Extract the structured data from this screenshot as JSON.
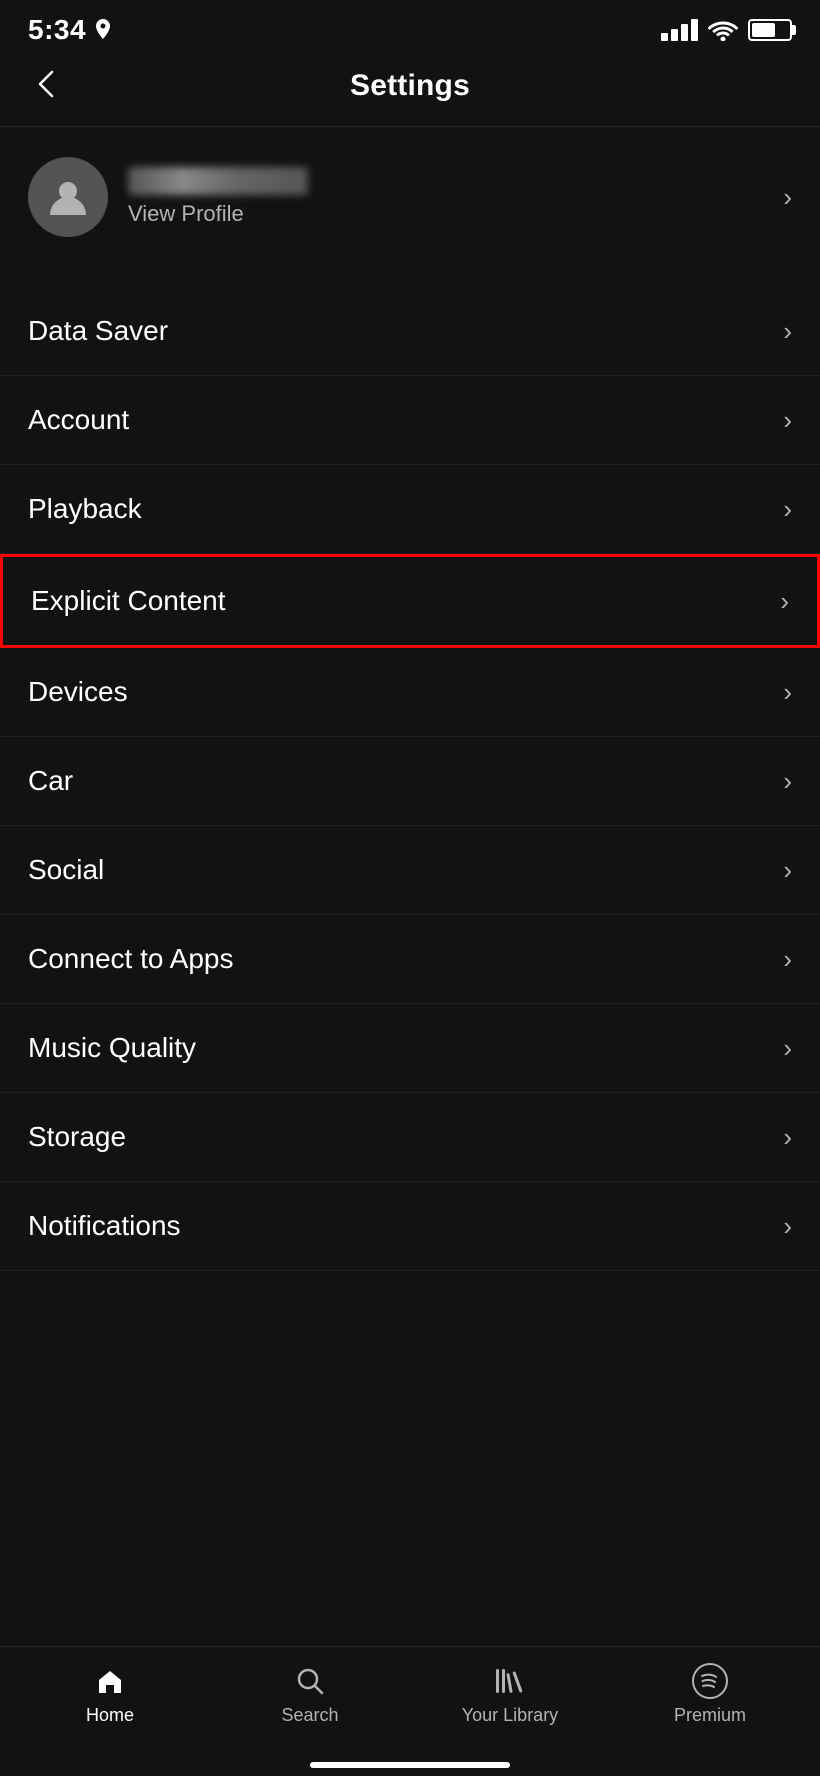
{
  "statusBar": {
    "time": "5:34",
    "locationIcon": "›"
  },
  "header": {
    "title": "Settings",
    "backLabel": "<"
  },
  "profile": {
    "viewProfileLabel": "View Profile",
    "blurredName": ""
  },
  "settingsItems": [
    {
      "id": "data-saver",
      "label": "Data Saver",
      "highlighted": false
    },
    {
      "id": "account",
      "label": "Account",
      "highlighted": false
    },
    {
      "id": "playback",
      "label": "Playback",
      "highlighted": false
    },
    {
      "id": "explicit-content",
      "label": "Explicit Content",
      "highlighted": true
    },
    {
      "id": "devices",
      "label": "Devices",
      "highlighted": false
    },
    {
      "id": "car",
      "label": "Car",
      "highlighted": false
    },
    {
      "id": "social",
      "label": "Social",
      "highlighted": false
    },
    {
      "id": "connect-to-apps",
      "label": "Connect to Apps",
      "highlighted": false
    },
    {
      "id": "music-quality",
      "label": "Music Quality",
      "highlighted": false
    },
    {
      "id": "storage",
      "label": "Storage",
      "highlighted": false
    },
    {
      "id": "notifications",
      "label": "Notifications",
      "highlighted": false
    }
  ],
  "bottomNav": {
    "items": [
      {
        "id": "home",
        "label": "Home",
        "active": true
      },
      {
        "id": "search",
        "label": "Search",
        "active": false
      },
      {
        "id": "your-library",
        "label": "Your Library",
        "active": false
      },
      {
        "id": "premium",
        "label": "Premium",
        "active": false
      }
    ]
  }
}
